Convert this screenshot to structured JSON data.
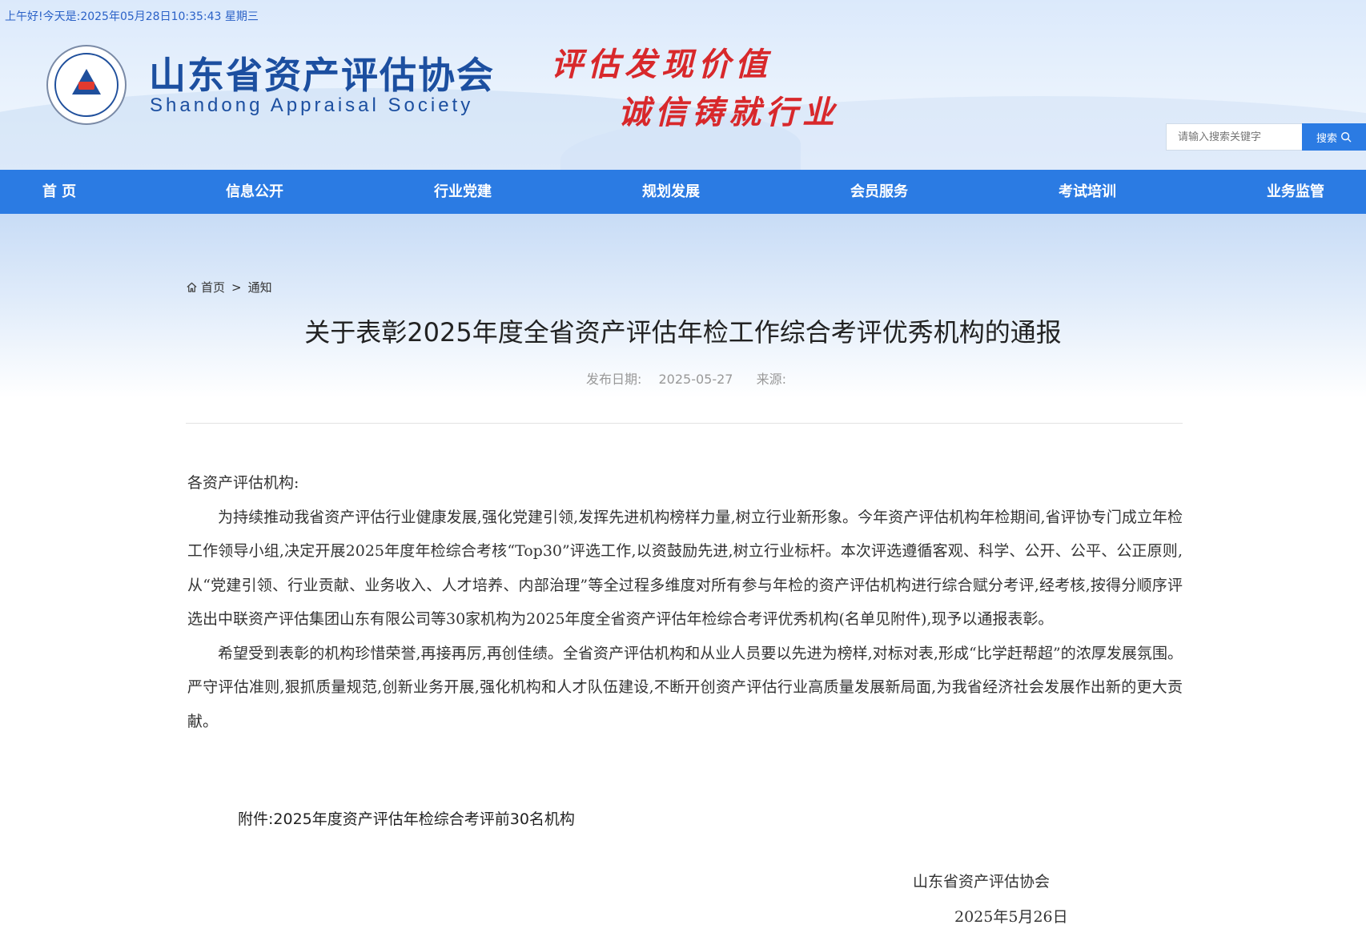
{
  "header": {
    "greeting": "上午好!今天是:2025年05月28日10:35:43 星期三",
    "site_title": "山东省资产评估协会",
    "site_subtitle": "Shandong Appraisal Society",
    "slogan_line1": "评估发现价值",
    "slogan_line2": "诚信铸就行业",
    "search_placeholder": "请输入搜索关键字",
    "search_button": "搜索"
  },
  "nav": {
    "items": [
      "首 页",
      "信息公开",
      "行业党建",
      "规划发展",
      "会员服务",
      "考试培训",
      "业务监管"
    ]
  },
  "breadcrumb": {
    "home": "首页",
    "separator": ">",
    "current": "通知"
  },
  "article": {
    "title": "关于表彰2025年度全省资产评估年检工作综合考评优秀机构的通报",
    "date_label": "发布日期:",
    "date": "2025-05-27",
    "source_label": "来源:",
    "salutation": "各资产评估机构:",
    "paragraph1": "为持续推动我省资产评估行业健康发展,强化党建引领,发挥先进机构榜样力量,树立行业新形象。今年资产评估机构年检期间,省评协专门成立年检工作领导小组,决定开展2025年度年检综合考核“Top30”评选工作,以资鼓励先进,树立行业标杆。本次评选遵循客观、科学、公开、公平、公正原则,从“党建引领、行业贡献、业务收入、人才培养、内部治理”等全过程多维度对所有参与年检的资产评估机构进行综合赋分考评,经考核,按得分顺序评选出中联资产评估集团山东有限公司等30家机构为2025年度全省资产评估年检综合考评优秀机构(名单见附件),现予以通报表彰。",
    "paragraph2": "希望受到表彰的机构珍惜荣誉,再接再厉,再创佳绩。全省资产评估机构和从业人员要以先进为榜样,对标对表,形成“比学赶帮超”的浓厚发展氛围。严守评估准则,狠抓质量规范,创新业务开展,强化机构和人才队伍建设,不断开创资产评估行业高质量发展新局面,为我省经济社会发展作出新的更大贡献。",
    "attachment": "附件:2025年度资产评估年检综合考评前30名机构",
    "sign_org": "山东省资产评估协会",
    "sign_date": "2025年5月26日"
  },
  "colors": {
    "brand_blue": "#2b7be3",
    "title_blue": "#1c4fa0",
    "slogan_red": "#d8282b"
  }
}
